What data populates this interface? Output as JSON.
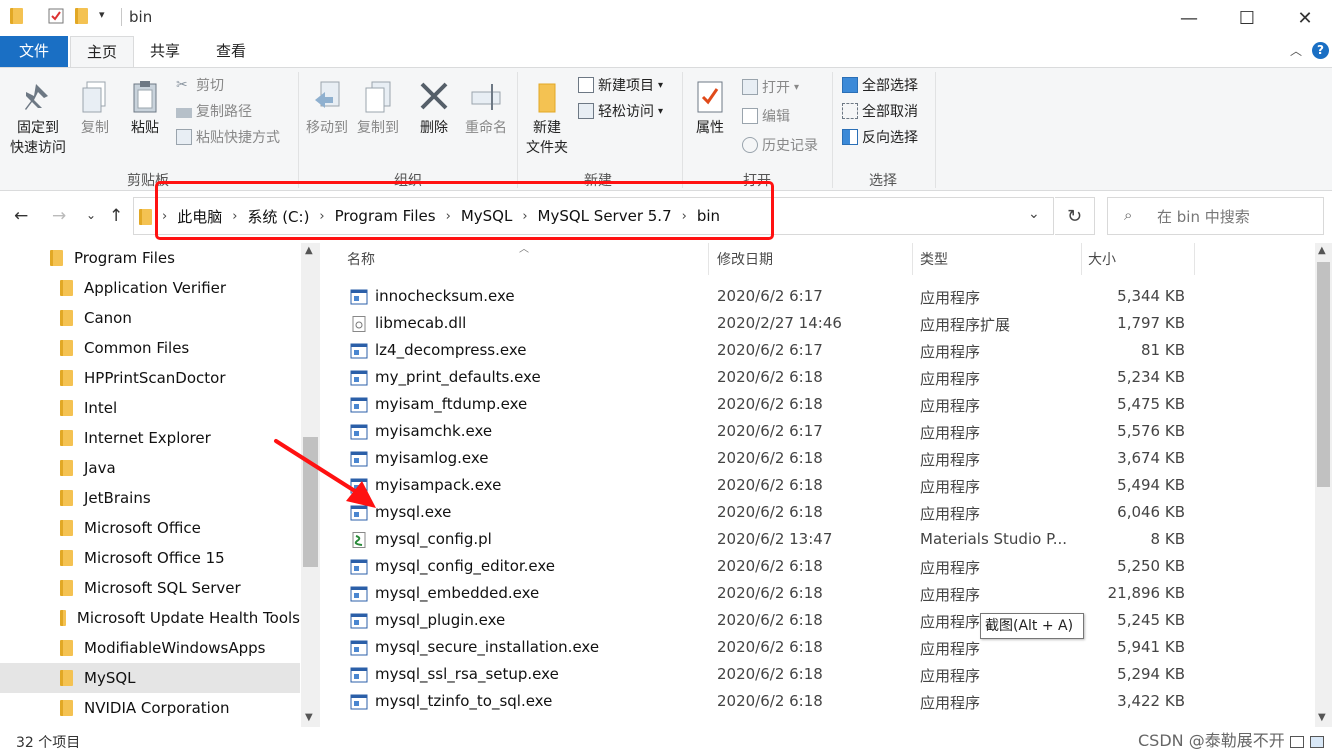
{
  "window": {
    "title": "bin",
    "min_glyph": "—",
    "max_glyph": "☐",
    "close_glyph": "✕"
  },
  "ribbon_tabs": {
    "file": "文件",
    "home": "主页",
    "share": "共享",
    "view": "查看"
  },
  "ribbon": {
    "clipboard": {
      "label": "剪贴板",
      "pin": "固定到",
      "pin2": "快速访问",
      "copy": "复制",
      "paste": "粘贴",
      "cut": "剪切",
      "copy_path": "复制路径",
      "paste_shortcut": "粘贴快捷方式"
    },
    "organize": {
      "label": "组织",
      "move_to": "移动到",
      "copy_to": "复制到",
      "delete": "删除",
      "rename": "重命名"
    },
    "new": {
      "label": "新建",
      "new_folder": "新建",
      "new_folder2": "文件夹",
      "new_item": "新建项目",
      "easy_access": "轻松访问"
    },
    "open": {
      "label": "打开",
      "properties": "属性",
      "open": "打开",
      "edit": "编辑",
      "history": "历史记录"
    },
    "select": {
      "label": "选择",
      "select_all": "全部选择",
      "select_none": "全部取消",
      "invert": "反向选择"
    }
  },
  "address": {
    "crumbs": [
      "此电脑",
      "系统 (C:)",
      "Program Files",
      "MySQL",
      "MySQL Server 5.7",
      "bin"
    ],
    "search_placeholder": "在 bin 中搜索"
  },
  "nav": {
    "items": [
      {
        "label": "Program Files",
        "selected": false
      },
      {
        "label": "Application Verifier",
        "selected": false
      },
      {
        "label": "Canon",
        "selected": false
      },
      {
        "label": "Common Files",
        "selected": false
      },
      {
        "label": "HPPrintScanDoctor",
        "selected": false
      },
      {
        "label": "Intel",
        "selected": false
      },
      {
        "label": "Internet Explorer",
        "selected": false
      },
      {
        "label": "Java",
        "selected": false
      },
      {
        "label": "JetBrains",
        "selected": false
      },
      {
        "label": "Microsoft Office",
        "selected": false
      },
      {
        "label": "Microsoft Office 15",
        "selected": false
      },
      {
        "label": "Microsoft SQL Server",
        "selected": false
      },
      {
        "label": "Microsoft Update Health Tools",
        "selected": false
      },
      {
        "label": "ModifiableWindowsApps",
        "selected": false
      },
      {
        "label": "MySQL",
        "selected": true
      },
      {
        "label": "NVIDIA Corporation",
        "selected": false
      }
    ]
  },
  "columns": {
    "name": "名称",
    "modified": "修改日期",
    "type": "类型",
    "size": "大小"
  },
  "files": [
    {
      "name": "innochecksum.exe",
      "date": "2020/6/2 6:17",
      "type": "应用程序",
      "size": "5,344 KB",
      "icon": "exe"
    },
    {
      "name": "libmecab.dll",
      "date": "2020/2/27 14:46",
      "type": "应用程序扩展",
      "size": "1,797 KB",
      "icon": "dll"
    },
    {
      "name": "lz4_decompress.exe",
      "date": "2020/6/2 6:17",
      "type": "应用程序",
      "size": "81 KB",
      "icon": "exe"
    },
    {
      "name": "my_print_defaults.exe",
      "date": "2020/6/2 6:18",
      "type": "应用程序",
      "size": "5,234 KB",
      "icon": "exe"
    },
    {
      "name": "myisam_ftdump.exe",
      "date": "2020/6/2 6:18",
      "type": "应用程序",
      "size": "5,475 KB",
      "icon": "exe"
    },
    {
      "name": "myisamchk.exe",
      "date": "2020/6/2 6:17",
      "type": "应用程序",
      "size": "5,576 KB",
      "icon": "exe"
    },
    {
      "name": "myisamlog.exe",
      "date": "2020/6/2 6:18",
      "type": "应用程序",
      "size": "3,674 KB",
      "icon": "exe"
    },
    {
      "name": "myisampack.exe",
      "date": "2020/6/2 6:18",
      "type": "应用程序",
      "size": "5,494 KB",
      "icon": "exe"
    },
    {
      "name": "mysql.exe",
      "date": "2020/6/2 6:18",
      "type": "应用程序",
      "size": "6,046 KB",
      "icon": "exe"
    },
    {
      "name": "mysql_config.pl",
      "date": "2020/6/2 13:47",
      "type": "Materials Studio P...",
      "size": "8 KB",
      "icon": "pl"
    },
    {
      "name": "mysql_config_editor.exe",
      "date": "2020/6/2 6:18",
      "type": "应用程序",
      "size": "5,250 KB",
      "icon": "exe"
    },
    {
      "name": "mysql_embedded.exe",
      "date": "2020/6/2 6:18",
      "type": "应用程序",
      "size": "21,896 KB",
      "icon": "exe"
    },
    {
      "name": "mysql_plugin.exe",
      "date": "2020/6/2 6:18",
      "type": "应用程序",
      "size": "5,245 KB",
      "icon": "exe"
    },
    {
      "name": "mysql_secure_installation.exe",
      "date": "2020/6/2 6:18",
      "type": "应用程序",
      "size": "5,941 KB",
      "icon": "exe"
    },
    {
      "name": "mysql_ssl_rsa_setup.exe",
      "date": "2020/6/2 6:18",
      "type": "应用程序",
      "size": "5,294 KB",
      "icon": "exe"
    },
    {
      "name": "mysql_tzinfo_to_sql.exe",
      "date": "2020/6/2 6:18",
      "type": "应用程序",
      "size": "3,422 KB",
      "icon": "exe"
    }
  ],
  "tooltip": "截图(Alt + A)",
  "status": {
    "count": "32 个项目"
  },
  "watermark": "CSDN @泰勒展不开",
  "colors": {
    "file_tab": "#1a6fc4",
    "highlight": "#ff1111",
    "folder": "#f4c252"
  }
}
